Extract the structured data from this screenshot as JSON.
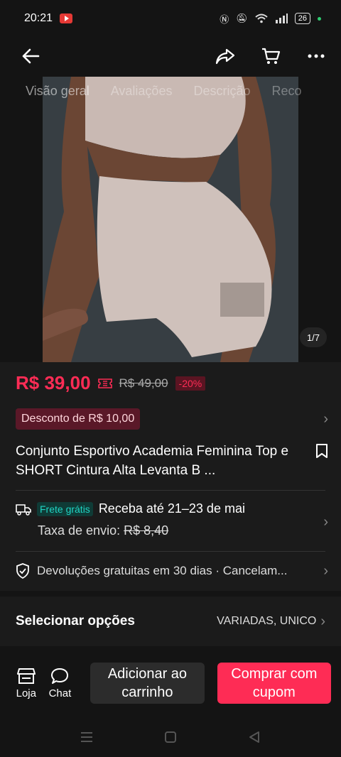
{
  "status_bar": {
    "time": "20:21",
    "battery": "26"
  },
  "gallery": {
    "tabs": [
      "Visão geral",
      "Avaliações",
      "Descrição",
      "Reco"
    ],
    "counter": "1/7"
  },
  "price": {
    "current": "R$ 39,00",
    "original": "R$ 49,00",
    "discount": "-20%"
  },
  "coupon": {
    "label": "Desconto de R$ 10,00"
  },
  "product": {
    "title": "Conjunto Esportivo Academia Feminina Top e SHORT Cintura Alta Levanta B ..."
  },
  "shipping": {
    "free_badge": "Frete grátis",
    "eta": "Receba até 21–23 de mai",
    "fee_label": "Taxa de envio:",
    "fee_value": "R$ 8,40"
  },
  "returns": {
    "text": "Devoluções gratuitas em 30 dias · Cancelam..."
  },
  "options": {
    "label": "Selecionar opções",
    "value": "VARIADAS, UNICO"
  },
  "bottom_bar": {
    "store_label": "Loja",
    "chat_label": "Chat",
    "add_to_cart": "Adicionar ao carrinho",
    "buy_with_coupon": "Comprar com cupom"
  },
  "colors": {
    "accent": "#fe2c55",
    "teal": "#20d5c4",
    "background": "#141414"
  }
}
